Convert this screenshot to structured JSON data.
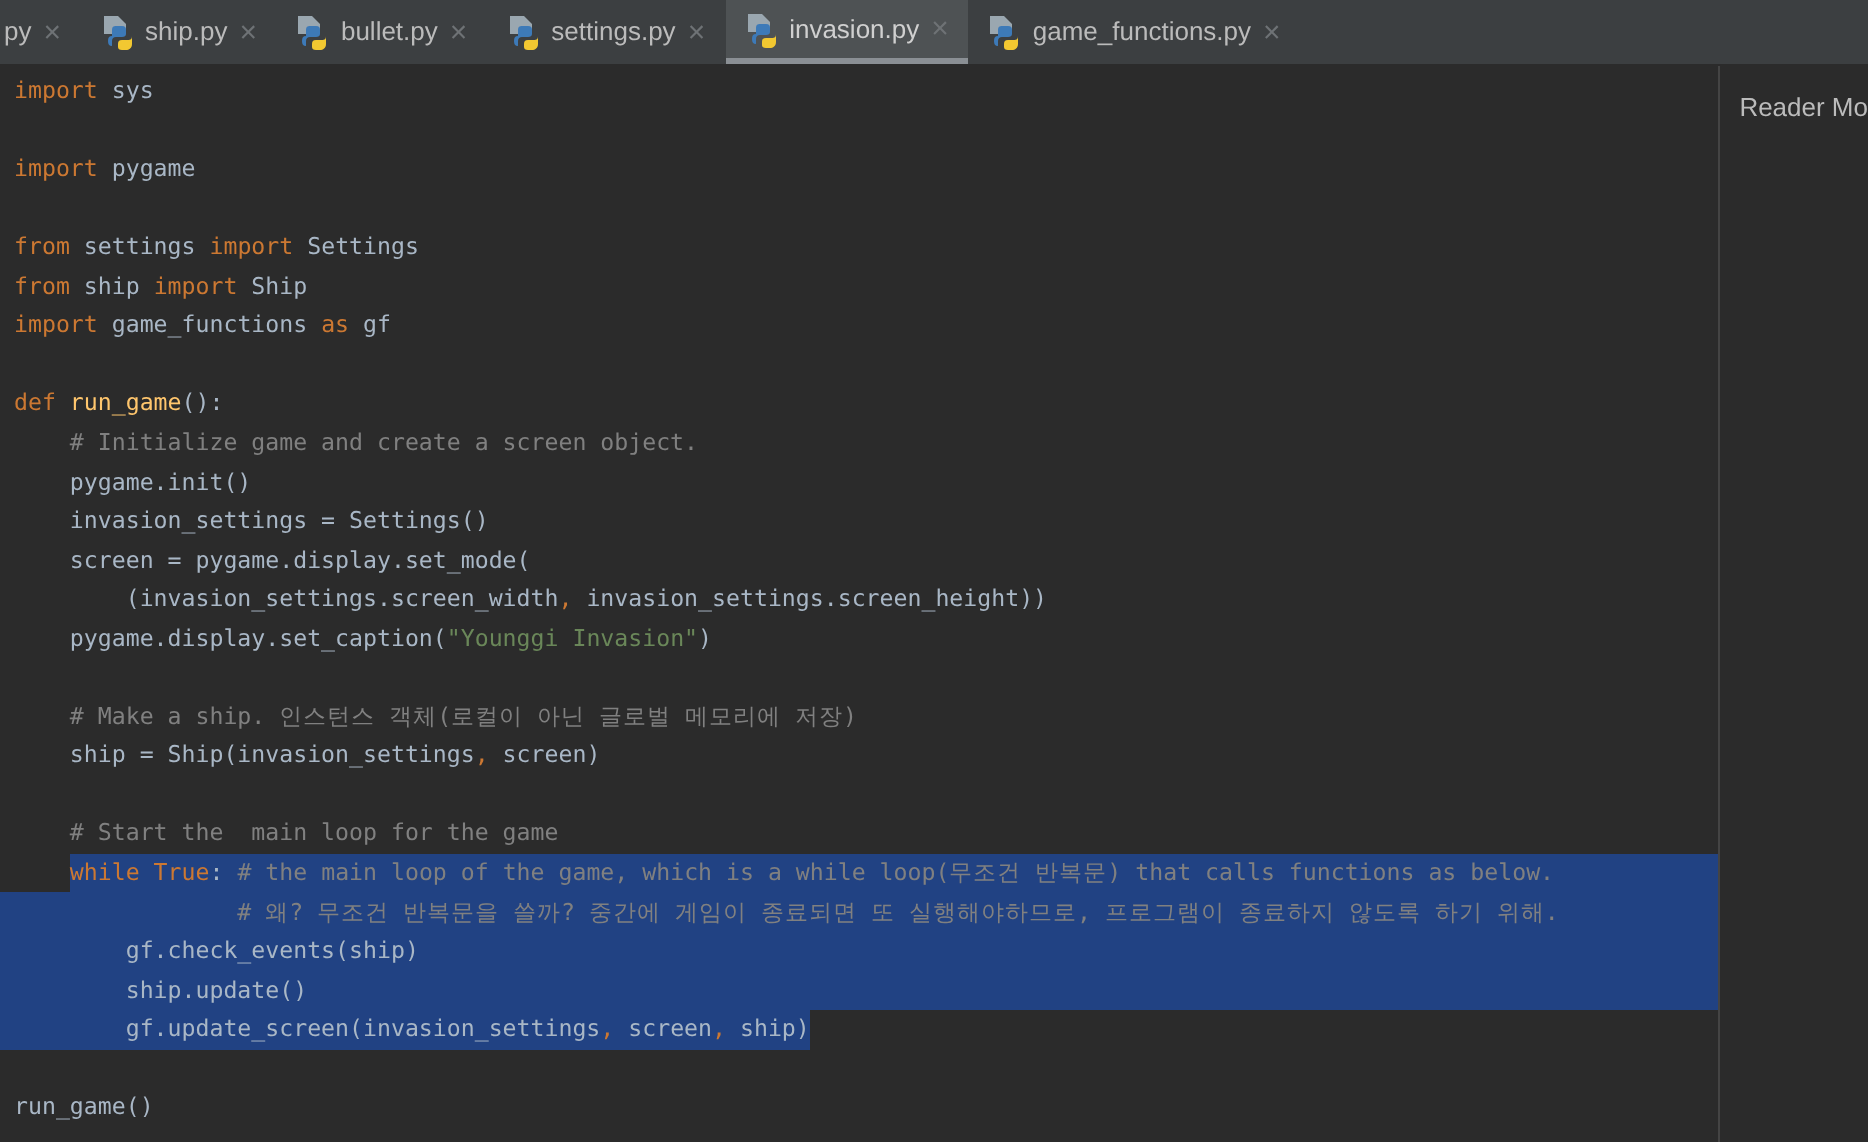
{
  "tabs": [
    {
      "label": "py",
      "selected": false,
      "icon": false
    },
    {
      "label": "ship.py",
      "selected": false,
      "icon": true
    },
    {
      "label": "bullet.py",
      "selected": false,
      "icon": true
    },
    {
      "label": "settings.py",
      "selected": false,
      "icon": true
    },
    {
      "label": "invasion.py",
      "selected": true,
      "icon": true
    },
    {
      "label": "game_functions.py",
      "selected": false,
      "icon": true
    }
  ],
  "close_glyph": "×",
  "reader_mode": "Reader Mo",
  "code_lines": [
    {
      "selected": false,
      "tokens": [
        {
          "kind": "keyword",
          "text": "import"
        },
        {
          "kind": "plain",
          "text": " sys"
        }
      ]
    },
    {
      "selected": false
    },
    {
      "selected": false,
      "tokens": [
        {
          "kind": "keyword",
          "text": "import"
        },
        {
          "kind": "plain",
          "text": " pygame"
        }
      ]
    },
    {
      "selected": false
    },
    {
      "selected": false,
      "tokens": [
        {
          "kind": "keyword",
          "text": "from"
        },
        {
          "kind": "plain",
          "text": " settings "
        },
        {
          "kind": "keyword",
          "text": "import"
        },
        {
          "kind": "plain",
          "text": " Settings"
        }
      ]
    },
    {
      "selected": false,
      "tokens": [
        {
          "kind": "keyword",
          "text": "from"
        },
        {
          "kind": "plain",
          "text": " ship "
        },
        {
          "kind": "keyword",
          "text": "import"
        },
        {
          "kind": "plain",
          "text": " Ship"
        }
      ]
    },
    {
      "selected": false,
      "tokens": [
        {
          "kind": "keyword",
          "text": "import"
        },
        {
          "kind": "plain",
          "text": " game_functions "
        },
        {
          "kind": "keyword",
          "text": "as"
        },
        {
          "kind": "plain",
          "text": " gf"
        }
      ]
    },
    {
      "selected": false
    },
    {
      "selected": false,
      "tokens": [
        {
          "kind": "keyword",
          "text": "def "
        },
        {
          "kind": "function",
          "text": "run_game"
        },
        {
          "kind": "plain",
          "text": "():"
        }
      ]
    },
    {
      "selected": false,
      "tokens": [
        {
          "kind": "comment",
          "text": "    # Initialize game and create a screen object."
        }
      ]
    },
    {
      "selected": false,
      "tokens": [
        {
          "kind": "plain",
          "text": "    pygame.init()"
        }
      ]
    },
    {
      "selected": false,
      "tokens": [
        {
          "kind": "plain",
          "text": "    invasion_settings = Settings()"
        }
      ]
    },
    {
      "selected": false,
      "tokens": [
        {
          "kind": "plain",
          "text": "    screen = pygame.display.set_mode("
        }
      ]
    },
    {
      "selected": false,
      "tokens": [
        {
          "kind": "plain",
          "text": "        (invasion_settings.screen_width"
        },
        {
          "kind": "keyword",
          "text": ","
        },
        {
          "kind": "plain",
          "text": " invasion_settings.screen_height))"
        }
      ]
    },
    {
      "selected": false,
      "tokens": [
        {
          "kind": "plain",
          "text": "    pygame.display.set_caption("
        },
        {
          "kind": "string",
          "text": "\"Younggi Invasion\""
        },
        {
          "kind": "plain",
          "text": ")"
        }
      ]
    },
    {
      "selected": false
    },
    {
      "selected": false,
      "tokens": [
        {
          "kind": "comment",
          "text": "    # Make a ship. 인스턴스 객체(로컬이 아닌 글로벌 메모리에 저장)"
        }
      ]
    },
    {
      "selected": false,
      "tokens": [
        {
          "kind": "plain",
          "text": "    ship = Ship(invasion_settings"
        },
        {
          "kind": "keyword",
          "text": ","
        },
        {
          "kind": "plain",
          "text": " screen)"
        }
      ]
    },
    {
      "selected": false
    },
    {
      "selected": false,
      "tokens": [
        {
          "kind": "comment",
          "text": "    # Start the  main loop for the game"
        }
      ]
    },
    {
      "selected": true,
      "tokens": [
        {
          "kind": "keyword",
          "text": "    while True"
        },
        {
          "kind": "plain",
          "text": ": "
        },
        {
          "kind": "comment",
          "text": "# the main loop of the game, which is a while loop(무조건 반복문) that calls functions as below."
        }
      ]
    },
    {
      "selected": true,
      "tokens": [
        {
          "kind": "comment",
          "text": "                # 왜? 무조건 반복문을 쓸까? 중간에 게임이 종료되면 또 실행해야하므로, 프로그램이 종료하지 않도록 하기 위해."
        }
      ]
    },
    {
      "selected": true,
      "tokens": [
        {
          "kind": "plain",
          "text": "        gf.check_events(ship)"
        }
      ]
    },
    {
      "selected": true,
      "tokens": [
        {
          "kind": "plain",
          "text": "        ship.update()"
        }
      ]
    },
    {
      "selected": true,
      "tokens": [
        {
          "kind": "plain",
          "text": "        gf.update_screen(invasion_settings"
        },
        {
          "kind": "keyword",
          "text": ","
        },
        {
          "kind": "plain",
          "text": " screen"
        },
        {
          "kind": "keyword",
          "text": ","
        },
        {
          "kind": "plain",
          "text": " ship)"
        }
      ]
    },
    {
      "selected": false
    },
    {
      "selected": false,
      "tokens": [
        {
          "kind": "plain",
          "text": "run_game()"
        }
      ]
    }
  ]
}
